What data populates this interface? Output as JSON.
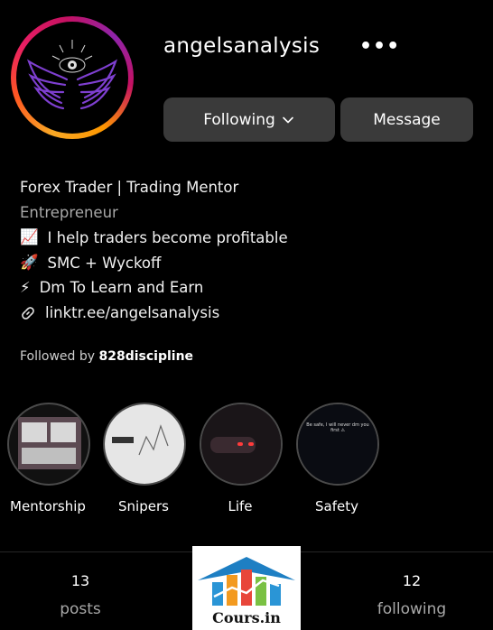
{
  "profile": {
    "username": "angelsanalysis",
    "more_icon": "•••",
    "following_label": "Following",
    "message_label": "Message"
  },
  "bio": {
    "line1": "Forex Trader | Trading Mentor",
    "line2": "Entrepreneur",
    "line3_icon": "📈",
    "line3": "I help traders become profitable",
    "line4_icon": "🚀",
    "line4": "SMC + Wyckoff",
    "line5_icon": "⚡",
    "line5": "Dm To Learn and Earn",
    "link": "linktr.ee/angelsanalysis"
  },
  "followed_by": {
    "prefix": "Followed by",
    "name": "828discipline"
  },
  "highlights": [
    {
      "label": "Mentorship"
    },
    {
      "label": "Snipers"
    },
    {
      "label": "Life"
    },
    {
      "label": "Safety",
      "story_text": "Be safe, I will never dm you first ⚠"
    }
  ],
  "stats": {
    "posts_count": "13",
    "posts_label": "posts",
    "following_count": "12",
    "following_label": "following"
  },
  "watermark": {
    "text": "Cours.in"
  },
  "colors": {
    "background": "#000000",
    "button": "#3a3a3a",
    "muted": "#a8a8a8",
    "ring_start": "#f9a825",
    "ring_end": "#c51162",
    "wings": "#7e3fd0"
  }
}
